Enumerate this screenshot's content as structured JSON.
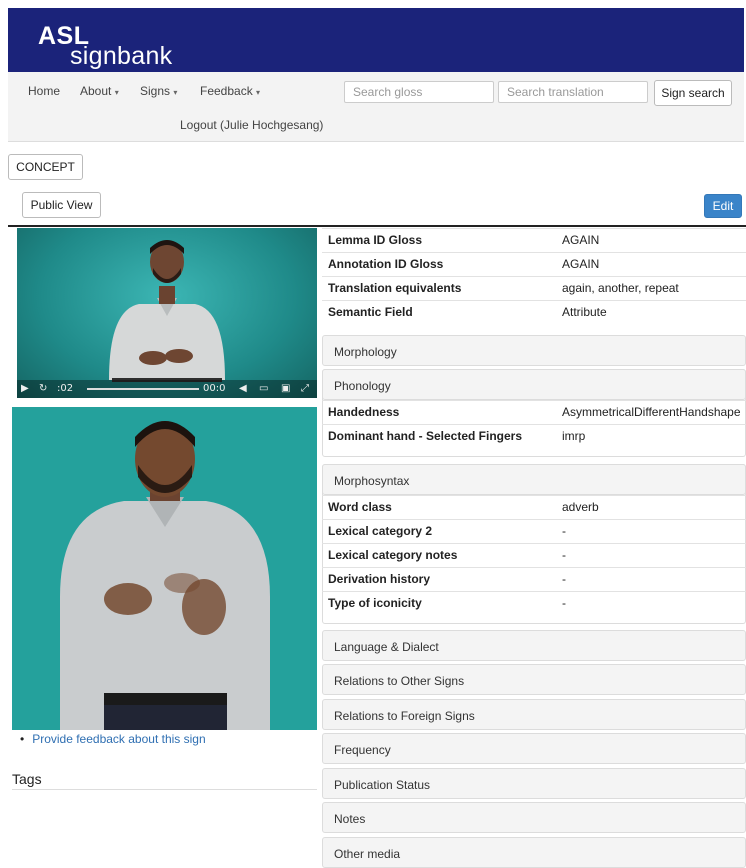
{
  "brand": {
    "line1": "ASL",
    "line2": "signbank"
  },
  "nav": {
    "home": "Home",
    "about": "About",
    "signs": "Signs",
    "feedback": "Feedback",
    "caret": "▾",
    "search_gloss_placeholder": "Search gloss",
    "search_translation_placeholder": "Search translation",
    "sign_search": "Sign search",
    "logout": "Logout (Julie Hochgesang)"
  },
  "concept_button": "CONCEPT",
  "public_view_button": "Public View",
  "edit_button": "Edit",
  "video": {
    "time_current": ":02",
    "time_end": "00:0"
  },
  "feedback_link": "Provide feedback about this sign",
  "tags_title": "Tags",
  "fields": {
    "lemma": {
      "label": "Lemma ID Gloss",
      "value": "AGAIN"
    },
    "annotation": {
      "label": "Annotation ID Gloss",
      "value": "AGAIN"
    },
    "translation": {
      "label": "Translation equivalents",
      "value": "again, another, repeat"
    },
    "semantic": {
      "label": "Semantic Field",
      "value": "Attribute"
    },
    "handedness": {
      "label": "Handedness",
      "value": "AsymmetricalDifferentHandshape"
    },
    "selected_fingers": {
      "label": "Dominant hand - Selected Fingers",
      "value": "imrp"
    },
    "word_class": {
      "label": "Word class",
      "value": "adverb"
    },
    "lexcat2": {
      "label": "Lexical category 2",
      "value": "-"
    },
    "lexnotes": {
      "label": "Lexical category notes",
      "value": "-"
    },
    "derivation": {
      "label": "Derivation history",
      "value": "-"
    },
    "iconicity": {
      "label": "Type of iconicity",
      "value": "-"
    }
  },
  "panels": {
    "morphology": "Morphology",
    "phonology": "Phonology",
    "morphosyntax": "Morphosyntax",
    "language": "Language & Dialect",
    "relations_other": "Relations to Other Signs",
    "relations_foreign": "Relations to Foreign Signs",
    "frequency": "Frequency",
    "publication": "Publication Status",
    "notes": "Notes",
    "other_media": "Other media"
  },
  "colors": {
    "banner": "#1b237a",
    "edit": "#3a84c9",
    "video_bg": "#2a9e9c",
    "image_bg": "#24a19c",
    "link": "#2f6fb2"
  }
}
